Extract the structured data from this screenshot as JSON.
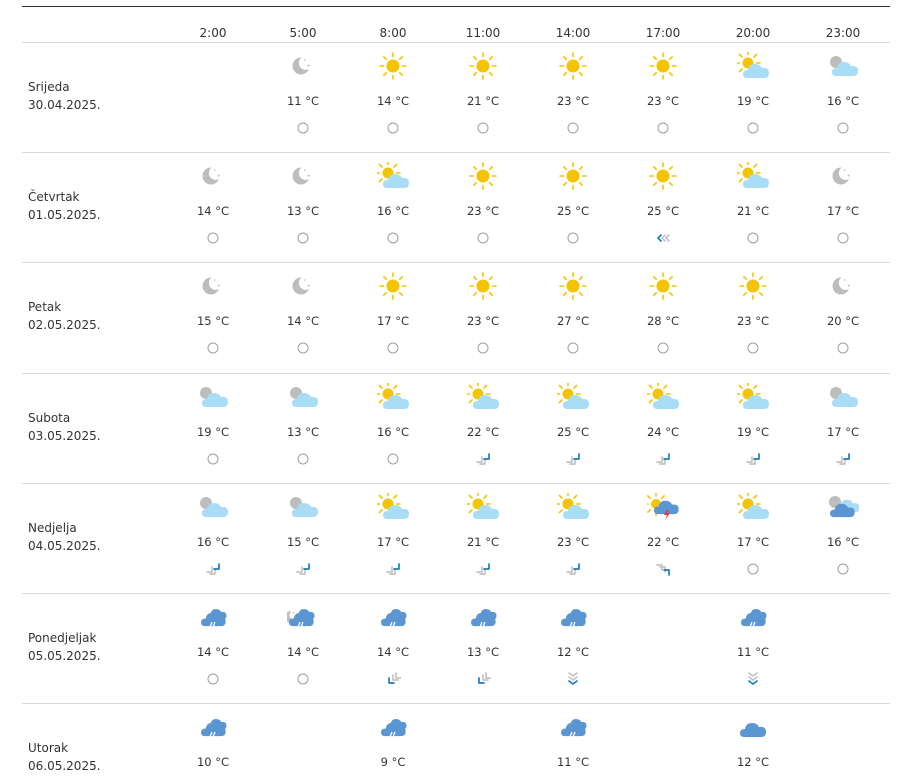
{
  "header": {
    "times": [
      "2:00",
      "5:00",
      "8:00",
      "11:00",
      "14:00",
      "17:00",
      "20:00",
      "23:00"
    ]
  },
  "colors": {
    "sun": "#f5c400",
    "cloud_light": "#a9dcf5",
    "cloud_dark": "#5b96d2",
    "moon": "#bdbdbd",
    "wind_gray": "#c4c4c4",
    "wind_blue": "#1b7fb5",
    "lightning": "#e53935"
  },
  "days": [
    {
      "name": "Srijeda",
      "date": "30.04.2025.",
      "cells": [
        null,
        {
          "icon": "moon-icon",
          "temp": "11 °C",
          "wind": "calm"
        },
        {
          "icon": "sun-icon",
          "temp": "14 °C",
          "wind": "calm"
        },
        {
          "icon": "sun-icon",
          "temp": "21 °C",
          "wind": "calm"
        },
        {
          "icon": "sun-icon",
          "temp": "23 °C",
          "wind": "calm"
        },
        {
          "icon": "sun-icon",
          "temp": "23 °C",
          "wind": "calm"
        },
        {
          "icon": "sun-cloud-icon",
          "temp": "19 °C",
          "wind": "calm"
        },
        {
          "icon": "moon-cloud-icon",
          "temp": "16 °C",
          "wind": "calm"
        }
      ]
    },
    {
      "name": "Četvrtak",
      "date": "01.05.2025.",
      "cells": [
        {
          "icon": "moon-icon",
          "temp": "14 °C",
          "wind": "calm"
        },
        {
          "icon": "moon-icon",
          "temp": "13 °C",
          "wind": "calm"
        },
        {
          "icon": "sun-cloud-icon",
          "temp": "16 °C",
          "wind": "calm"
        },
        {
          "icon": "sun-icon",
          "temp": "23 °C",
          "wind": "calm"
        },
        {
          "icon": "sun-icon",
          "temp": "25 °C",
          "wind": "calm"
        },
        {
          "icon": "sun-icon",
          "temp": "25 °C",
          "wind": "left"
        },
        {
          "icon": "sun-cloud-icon",
          "temp": "21 °C",
          "wind": "calm"
        },
        {
          "icon": "moon-icon",
          "temp": "17 °C",
          "wind": "calm"
        }
      ]
    },
    {
      "name": "Petak",
      "date": "02.05.2025.",
      "cells": [
        {
          "icon": "moon-icon",
          "temp": "15 °C",
          "wind": "calm"
        },
        {
          "icon": "moon-icon",
          "temp": "14 °C",
          "wind": "calm"
        },
        {
          "icon": "sun-icon",
          "temp": "17 °C",
          "wind": "calm"
        },
        {
          "icon": "sun-icon",
          "temp": "23 °C",
          "wind": "calm"
        },
        {
          "icon": "sun-icon",
          "temp": "27 °C",
          "wind": "calm"
        },
        {
          "icon": "sun-icon",
          "temp": "28 °C",
          "wind": "calm"
        },
        {
          "icon": "sun-icon",
          "temp": "23 °C",
          "wind": "calm"
        },
        {
          "icon": "moon-icon",
          "temp": "20 °C",
          "wind": "calm"
        }
      ]
    },
    {
      "name": "Subota",
      "date": "03.05.2025.",
      "cells": [
        {
          "icon": "moon-cloud-icon",
          "temp": "19 °C",
          "wind": "calm"
        },
        {
          "icon": "moon-cloud-icon",
          "temp": "13 °C",
          "wind": "calm"
        },
        {
          "icon": "sun-cloud-icon",
          "temp": "16 °C",
          "wind": "calm"
        },
        {
          "icon": "sun-cloud-icon",
          "temp": "22 °C",
          "wind": "ne"
        },
        {
          "icon": "sun-cloud-icon",
          "temp": "25 °C",
          "wind": "ne"
        },
        {
          "icon": "sun-cloud-icon",
          "temp": "24 °C",
          "wind": "ne"
        },
        {
          "icon": "sun-cloud-icon",
          "temp": "19 °C",
          "wind": "ne"
        },
        {
          "icon": "moon-cloud-icon",
          "temp": "17 °C",
          "wind": "ne"
        }
      ]
    },
    {
      "name": "Nedjelja",
      "date": "04.05.2025.",
      "cells": [
        {
          "icon": "moon-cloud-icon",
          "temp": "16 °C",
          "wind": "ne"
        },
        {
          "icon": "moon-cloud-icon",
          "temp": "15 °C",
          "wind": "ne"
        },
        {
          "icon": "sun-cloud-icon",
          "temp": "17 °C",
          "wind": "ne"
        },
        {
          "icon": "sun-cloud-icon",
          "temp": "21 °C",
          "wind": "ne"
        },
        {
          "icon": "sun-cloud-icon",
          "temp": "23 °C",
          "wind": "ne"
        },
        {
          "icon": "thunderstorm-icon",
          "temp": "22 °C",
          "wind": "se"
        },
        {
          "icon": "sun-cloud-icon",
          "temp": "17 °C",
          "wind": "calm"
        },
        {
          "icon": "moon-dark-cloud-icon",
          "temp": "16 °C",
          "wind": "calm"
        }
      ]
    },
    {
      "name": "Ponedjeljak",
      "date": "05.05.2025.",
      "cells": [
        {
          "icon": "rain-cloud-icon",
          "temp": "14 °C",
          "wind": "calm"
        },
        {
          "icon": "moon-rain-cloud-icon",
          "temp": "14 °C",
          "wind": "calm"
        },
        {
          "icon": "rain-cloud-icon",
          "temp": "14 °C",
          "wind": "sw"
        },
        {
          "icon": "rain-cloud-icon",
          "temp": "13 °C",
          "wind": "sw"
        },
        {
          "icon": "rain-cloud-icon",
          "temp": "12 °C",
          "wind": "down"
        },
        null,
        {
          "icon": "rain-cloud-icon",
          "temp": "11 °C",
          "wind": "down"
        },
        null
      ]
    },
    {
      "name": "Utorak",
      "date": "06.05.2025.",
      "cells": [
        {
          "icon": "rain-cloud-icon",
          "temp": "10 °C",
          "wind": null
        },
        null,
        {
          "icon": "rain-cloud-icon",
          "temp": "9 °C",
          "wind": null
        },
        null,
        {
          "icon": "rain-cloud-icon",
          "temp": "11 °C",
          "wind": null
        },
        null,
        {
          "icon": "cloud-icon",
          "temp": "12 °C",
          "wind": null
        },
        null
      ]
    }
  ]
}
